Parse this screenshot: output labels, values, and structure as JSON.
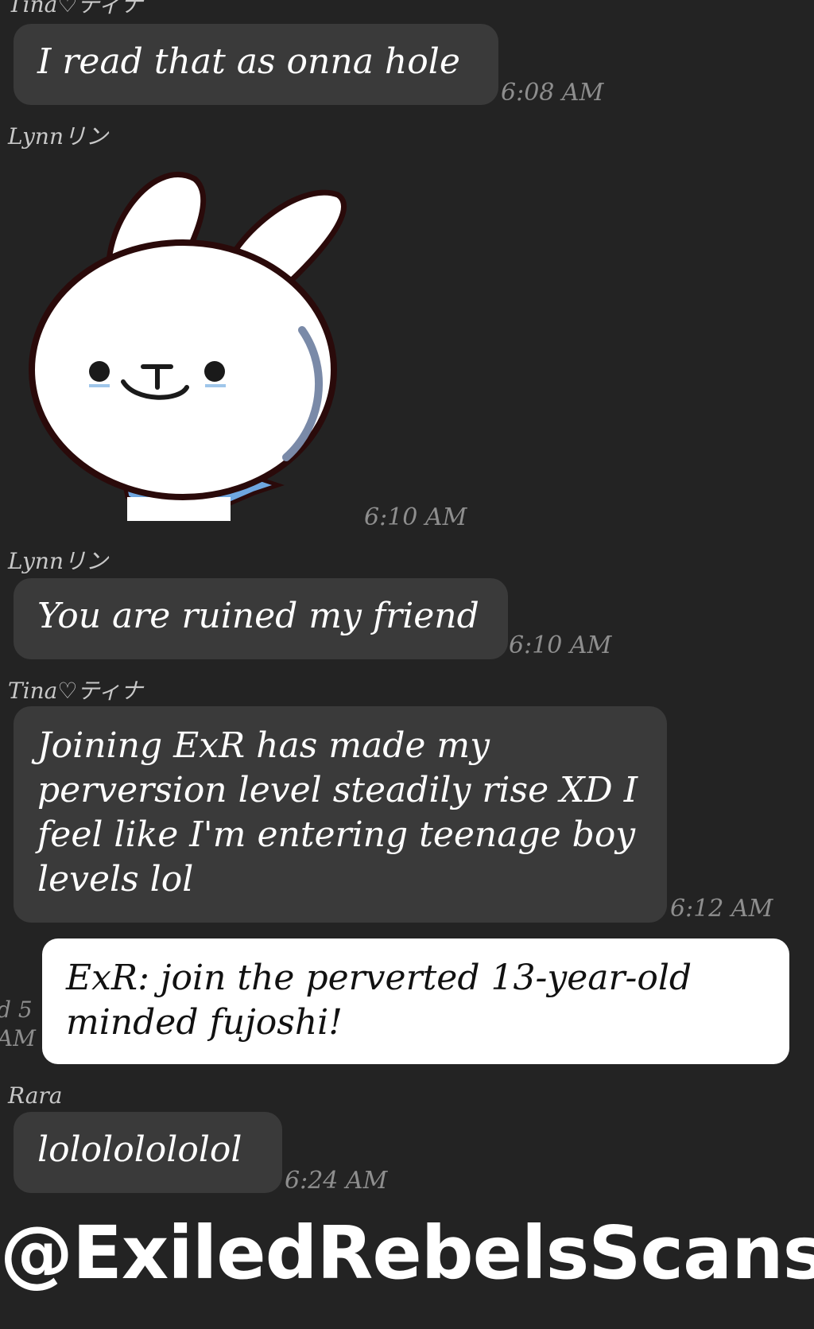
{
  "messages": [
    {
      "sender": "Tina♡ティナ",
      "text": "I read that as onna hole",
      "time": "6:08 AM"
    },
    {
      "sender": "Lynnリン",
      "sticker": "rabbit-sticker",
      "time": "6:10 AM"
    },
    {
      "sender": "Lynnリン",
      "text": "You are ruined my friend",
      "time": "6:10 AM"
    },
    {
      "sender": "Tina♡ティナ",
      "text": "Joining ExR has made my\nperversion level steadily rise XD I\nfeel like I'm entering teenage boy\nlevels lol",
      "time": "6:12 AM"
    },
    {
      "sender": "Rara",
      "text": "lolololololol",
      "time": "6:24 AM"
    }
  ],
  "note": {
    "text": "ExR: join the perverted 13-year-old\nminded fujoshi!",
    "cut_time_line1": "d 5",
    "cut_time_line2": "AM"
  },
  "watermark": "@ExiledRebelsScans",
  "colors": {
    "background": "#232323",
    "bubble": "#3a3a3a",
    "note_background": "#ffffff",
    "scarf": "#6fa6df"
  }
}
